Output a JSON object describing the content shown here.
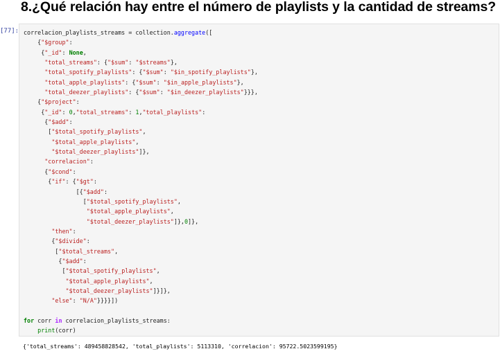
{
  "heading": "8.¿Qué relación hay entre el número de playlists y la cantidad de streams?",
  "cell": {
    "prompt": "[77]:",
    "code_lines": [
      "correlacion_playlists_streams = collection.aggregate([",
      "    {\"$group\":",
      "     {\"_id\": None,",
      "      \"total_streams\": {\"$sum\": \"$streams\"},",
      "      \"total_spotify_playlists\": {\"$sum\": \"$in_spotify_playlists\"},",
      "      \"total_apple_playlists\": {\"$sum\": \"$in_apple_playlists\"},",
      "      \"total_deezer_playlists\": {\"$sum\": \"$in_deezer_playlists\"}}},",
      "    {\"$project\":",
      "     {\"_id\": 0,\"total_streams\": 1,\"total_playlists\":",
      "      {\"$add\":",
      "       [\"$total_spotify_playlists\",",
      "        \"$total_apple_playlists\",",
      "        \"$total_deezer_playlists\"]},",
      "      \"correlacion\":",
      "      {\"$cond\":",
      "       {\"if\": {\"$gt\":",
      "               [{\"$add\":",
      "                 [\"$total_spotify_playlists\",",
      "                  \"$total_apple_playlists\",",
      "                  \"$total_deezer_playlists\"]},0]},",
      "        \"then\":",
      "        {\"$divide\":",
      "         [\"$total_streams\",",
      "          {\"$add\":",
      "           [\"$total_spotify_playlists\",",
      "            \"$total_apple_playlists\",",
      "            \"$total_deezer_playlists\"]}]},",
      "        \"else\": \"N/A\"}}}}])",
      "",
      "for corr in correlacion_playlists_streams:",
      "    print(corr)"
    ]
  },
  "output": "{'total_streams': 489458828542, 'total_playlists': 5113310, 'correlacion': 95722.5023599195}"
}
